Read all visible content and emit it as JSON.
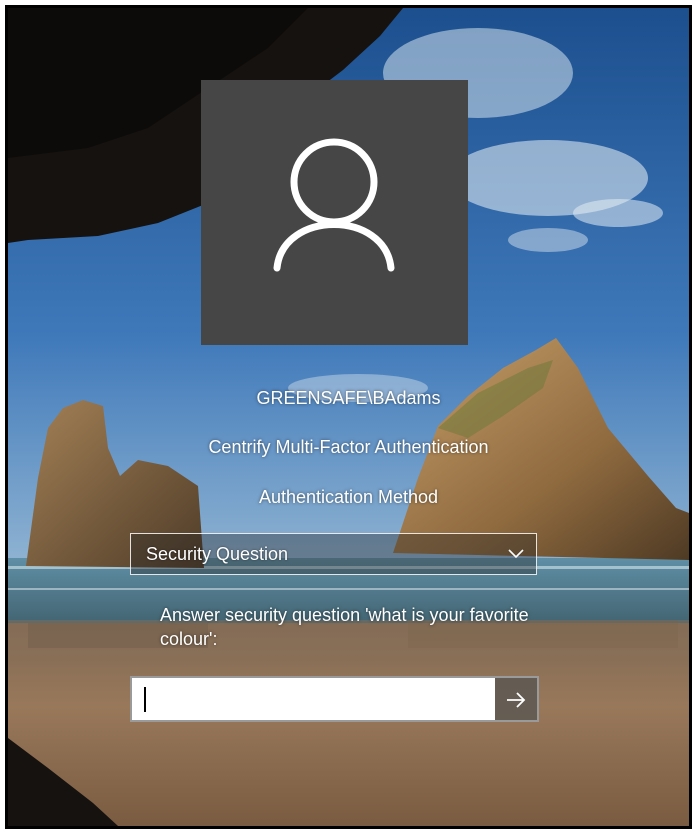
{
  "login": {
    "username": "GREENSAFE\\BAdams",
    "provider": "Centrify Multi-Factor Authentication",
    "method_label": "Authentication Method",
    "method_selected": "Security Question",
    "prompt": "Answer security question 'what is your favorite colour':",
    "answer_value": ""
  },
  "icons": {
    "avatar": "user-silhouette-icon",
    "dropdown": "chevron-down-icon",
    "submit": "arrow-right-icon"
  },
  "colors": {
    "avatar_tile": "#464646",
    "text": "#ffffff",
    "submit_button": "#5f5a52"
  }
}
